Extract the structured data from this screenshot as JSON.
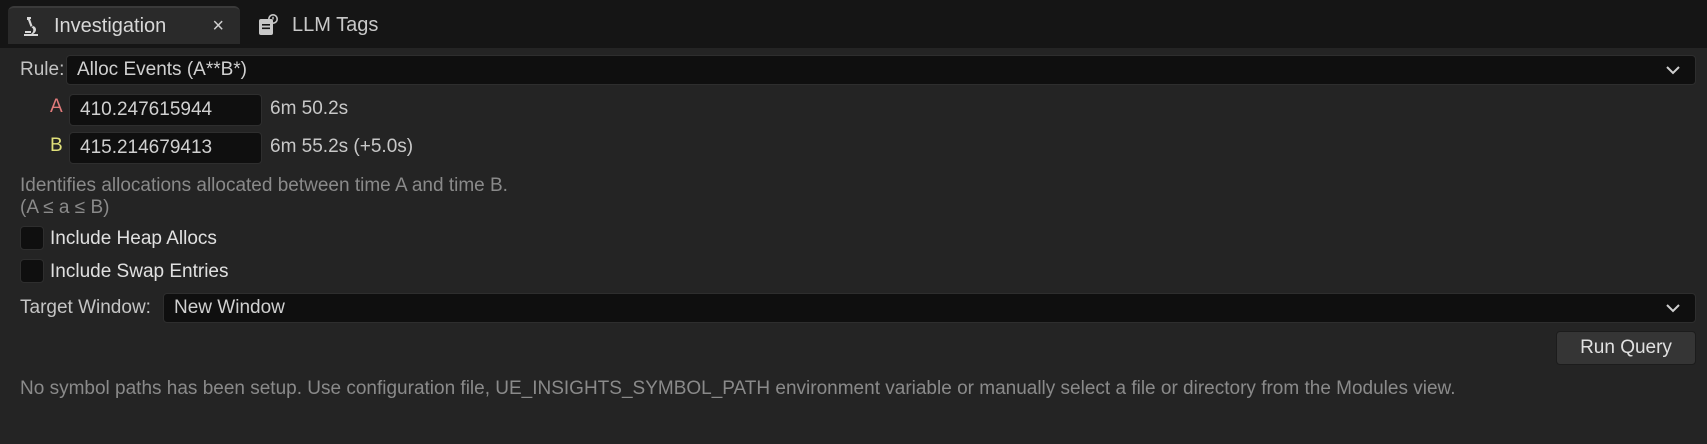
{
  "tabs": [
    {
      "label": "Investigation",
      "icon": "microscope-icon",
      "active": true,
      "close_glyph": "×"
    },
    {
      "label": "LLM Tags",
      "icon": "tag-document-icon",
      "active": false
    }
  ],
  "rule": {
    "label": "Rule:",
    "value": "Alloc Events (A**B*)"
  },
  "time_a": {
    "letter": "A",
    "value": "410.247615944",
    "display": "6m 50.2s"
  },
  "time_b": {
    "letter": "B",
    "value": "415.214679413",
    "display": "6m 55.2s (+5.0s)"
  },
  "description": {
    "line1": "Identifies allocations allocated between time A and time B.",
    "line2": "(A ≤ a ≤ B)"
  },
  "options": [
    {
      "label": "Include Heap Allocs",
      "checked": false
    },
    {
      "label": "Include Swap Entries",
      "checked": false
    }
  ],
  "target_window": {
    "label": "Target Window:",
    "value": "New Window"
  },
  "run_query_label": "Run Query",
  "symbol_note": "No symbol paths has been setup. Use configuration file, UE_INSIGHTS_SYMBOL_PATH environment variable or manually select a file or directory from the Modules view.",
  "colors": {
    "letter_a": "#e07a7a",
    "letter_b": "#e0e07a",
    "background": "#242424"
  }
}
